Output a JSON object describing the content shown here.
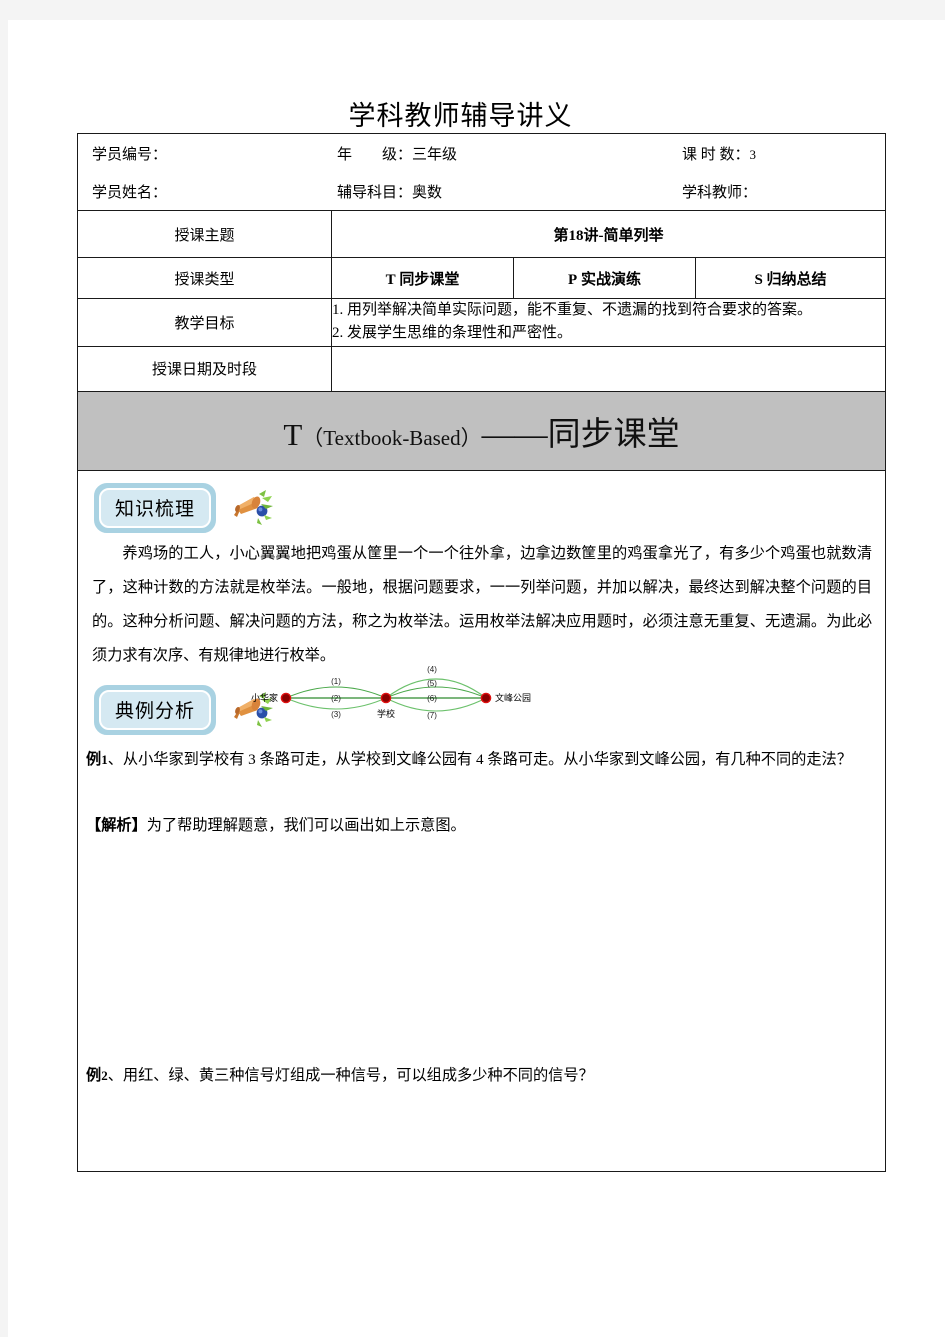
{
  "document": {
    "title": "学科教师辅导讲义"
  },
  "info_rows": [
    {
      "student_id_label": "学员编号：",
      "grade_label": "年　　级：",
      "grade_value": "三年级",
      "hours_label": "课 时 数：",
      "hours_value": "3"
    },
    {
      "student_name_label": "学员姓名：",
      "subject_label": "辅导科目：",
      "subject_value": "奥数",
      "teacher_label": "学科教师："
    }
  ],
  "table": {
    "topic_label": "授课主题",
    "topic_value_prefix": "第",
    "topic_value_number": "18",
    "topic_value_suffix": "讲-简单列举",
    "type_label": "授课类型",
    "types": [
      {
        "code": "T",
        "name": "同步课堂"
      },
      {
        "code": "P",
        "name": "实战演练"
      },
      {
        "code": "S",
        "name": "归纳总结"
      }
    ],
    "goals_label": "教学目标",
    "goals": [
      "1. 用列举解决简单实际问题，能不重复、不遗漏的找到符合要求的答案。",
      "2. 发展学生思维的条理性和严密性。"
    ],
    "date_label": "授课日期及时段",
    "date_value": ""
  },
  "banner": {
    "letter": "T",
    "paren_open": "（",
    "english": "Textbook-Based",
    "paren_close": "）",
    "dash": "——",
    "chinese": "同步课堂"
  },
  "sections": [
    {
      "badge": "知识梳理",
      "icon": "megaphone-icon",
      "body": "养鸡场的工人，小心翼翼地把鸡蛋从筐里一个一个往外拿，边拿边数筐里的鸡蛋拿光了，有多少个鸡蛋也就数清了，这种计数的方法就是枚举法。一般地，根据问题要求，一一列举问题，并加以解决，最终达到解决整个问题的目的。这种分析问题、解决问题的方法，称之为枚举法。运用枚举法解决应用题时，必须注意无重复、无遗漏。为此必须力求有次序、有规律地进行枚举。"
    },
    {
      "badge": "典例分析",
      "icon": "megaphone-icon"
    }
  ],
  "examples": [
    {
      "label": "例",
      "number": "1",
      "text": "、从小华家到学校有 3 条路可走，从学校到文峰公园有 4 条路可走。从小华家到文峰公园，有几种不同的走法？",
      "analysis_label": "【解析】",
      "analysis_text": "为了帮助理解题意，我们可以画出如上示意图。"
    },
    {
      "label": "例",
      "number": "2",
      "text": "、用红、绿、黄三种信号灯组成一种信号，可以组成多少种不同的信号？"
    }
  ],
  "diagram": {
    "nodes": [
      {
        "id": "home",
        "label": "小华家"
      },
      {
        "id": "school",
        "label": "学校"
      },
      {
        "id": "park",
        "label": "文峰公园"
      }
    ],
    "left_paths": [
      "(1)",
      "(2)",
      "(3)"
    ],
    "right_paths": [
      "(4)",
      "(5)",
      "(6)",
      "(7)"
    ],
    "node_color": "#8b0000",
    "node_ring_color": "#e01010",
    "edge_color": "#3a9a3a"
  },
  "colors": {
    "banner_bg": "#c0c0c0",
    "badge_border": "#a9d2e2",
    "badge_fill": "#d5e9f2",
    "page_bg": "#ffffff",
    "canvas_bg": "#f4f4f4",
    "border": "#1a1a1a"
  }
}
